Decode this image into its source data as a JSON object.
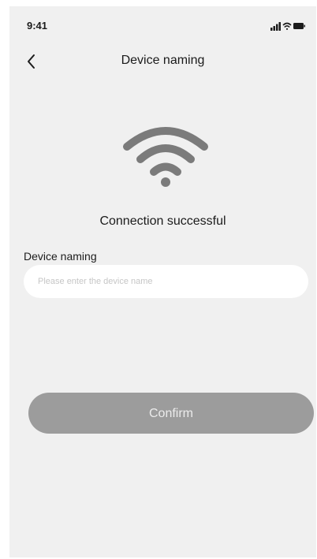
{
  "status_bar": {
    "time": "9:41",
    "icons": [
      "signal-icon",
      "wifi-small-icon",
      "battery-icon"
    ]
  },
  "header": {
    "back_icon": "chevron-left-icon",
    "title": "Device naming"
  },
  "main": {
    "status_icon": "wifi-icon",
    "status_message": "Connection successful",
    "name_field": {
      "label": "Device naming",
      "value": "",
      "placeholder": "Please enter the device name"
    },
    "confirm_label": "Confirm"
  },
  "colors": {
    "background": "#f0f0f0",
    "icon_gray": "#7b7b7b",
    "button_gray": "#9c9c9c",
    "input_background": "#ffffff"
  }
}
